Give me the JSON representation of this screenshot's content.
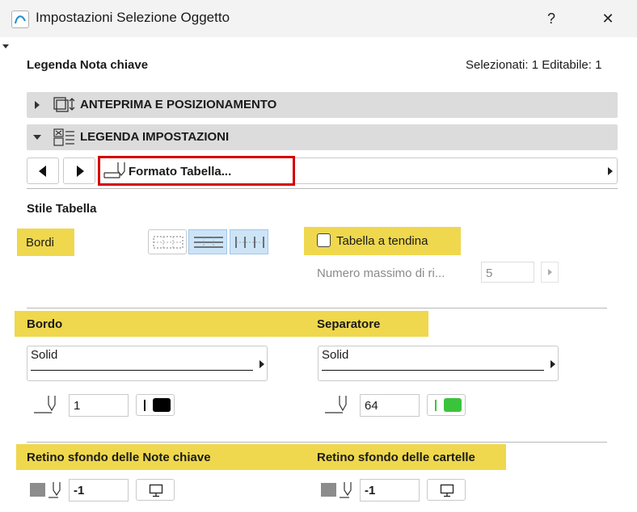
{
  "window": {
    "title": "Impostazioni Selezione Oggetto",
    "help_label": "?",
    "close_label": "✕"
  },
  "header": {
    "name": "Legenda Nota chiave",
    "status": "Selezionati: 1 Editabile: 1"
  },
  "sections": [
    {
      "label": "ANTEPRIMA E POSIZIONAMENTO",
      "expanded": false
    },
    {
      "label": "LEGENDA IMPOSTAZIONI",
      "expanded": true
    }
  ],
  "nav": {
    "panel_label": "Formato Tabella..."
  },
  "table_style": {
    "title": "Stile Tabella",
    "borders_label": "Bordi",
    "dropdown_label": "Tabella a tendina",
    "dropdown_checked": false,
    "max_rows_label": "Numero massimo di ri...",
    "max_rows_value": "5"
  },
  "border": {
    "title": "Bordo",
    "line_type": "Solid",
    "pen": "1",
    "pen_color": "#000000"
  },
  "separator": {
    "title": "Separatore",
    "line_type": "Solid",
    "pen": "64",
    "pen_color": "#3cc33c"
  },
  "bg_notes": {
    "title": "Retino sfondo delle Note chiave",
    "pen": "-1"
  },
  "bg_folders": {
    "title": "Retino sfondo delle cartelle",
    "pen": "-1"
  },
  "colors": {
    "highlight": "#efd84d",
    "selected_button": "#cde4f7",
    "focus_border": "#d40000"
  }
}
